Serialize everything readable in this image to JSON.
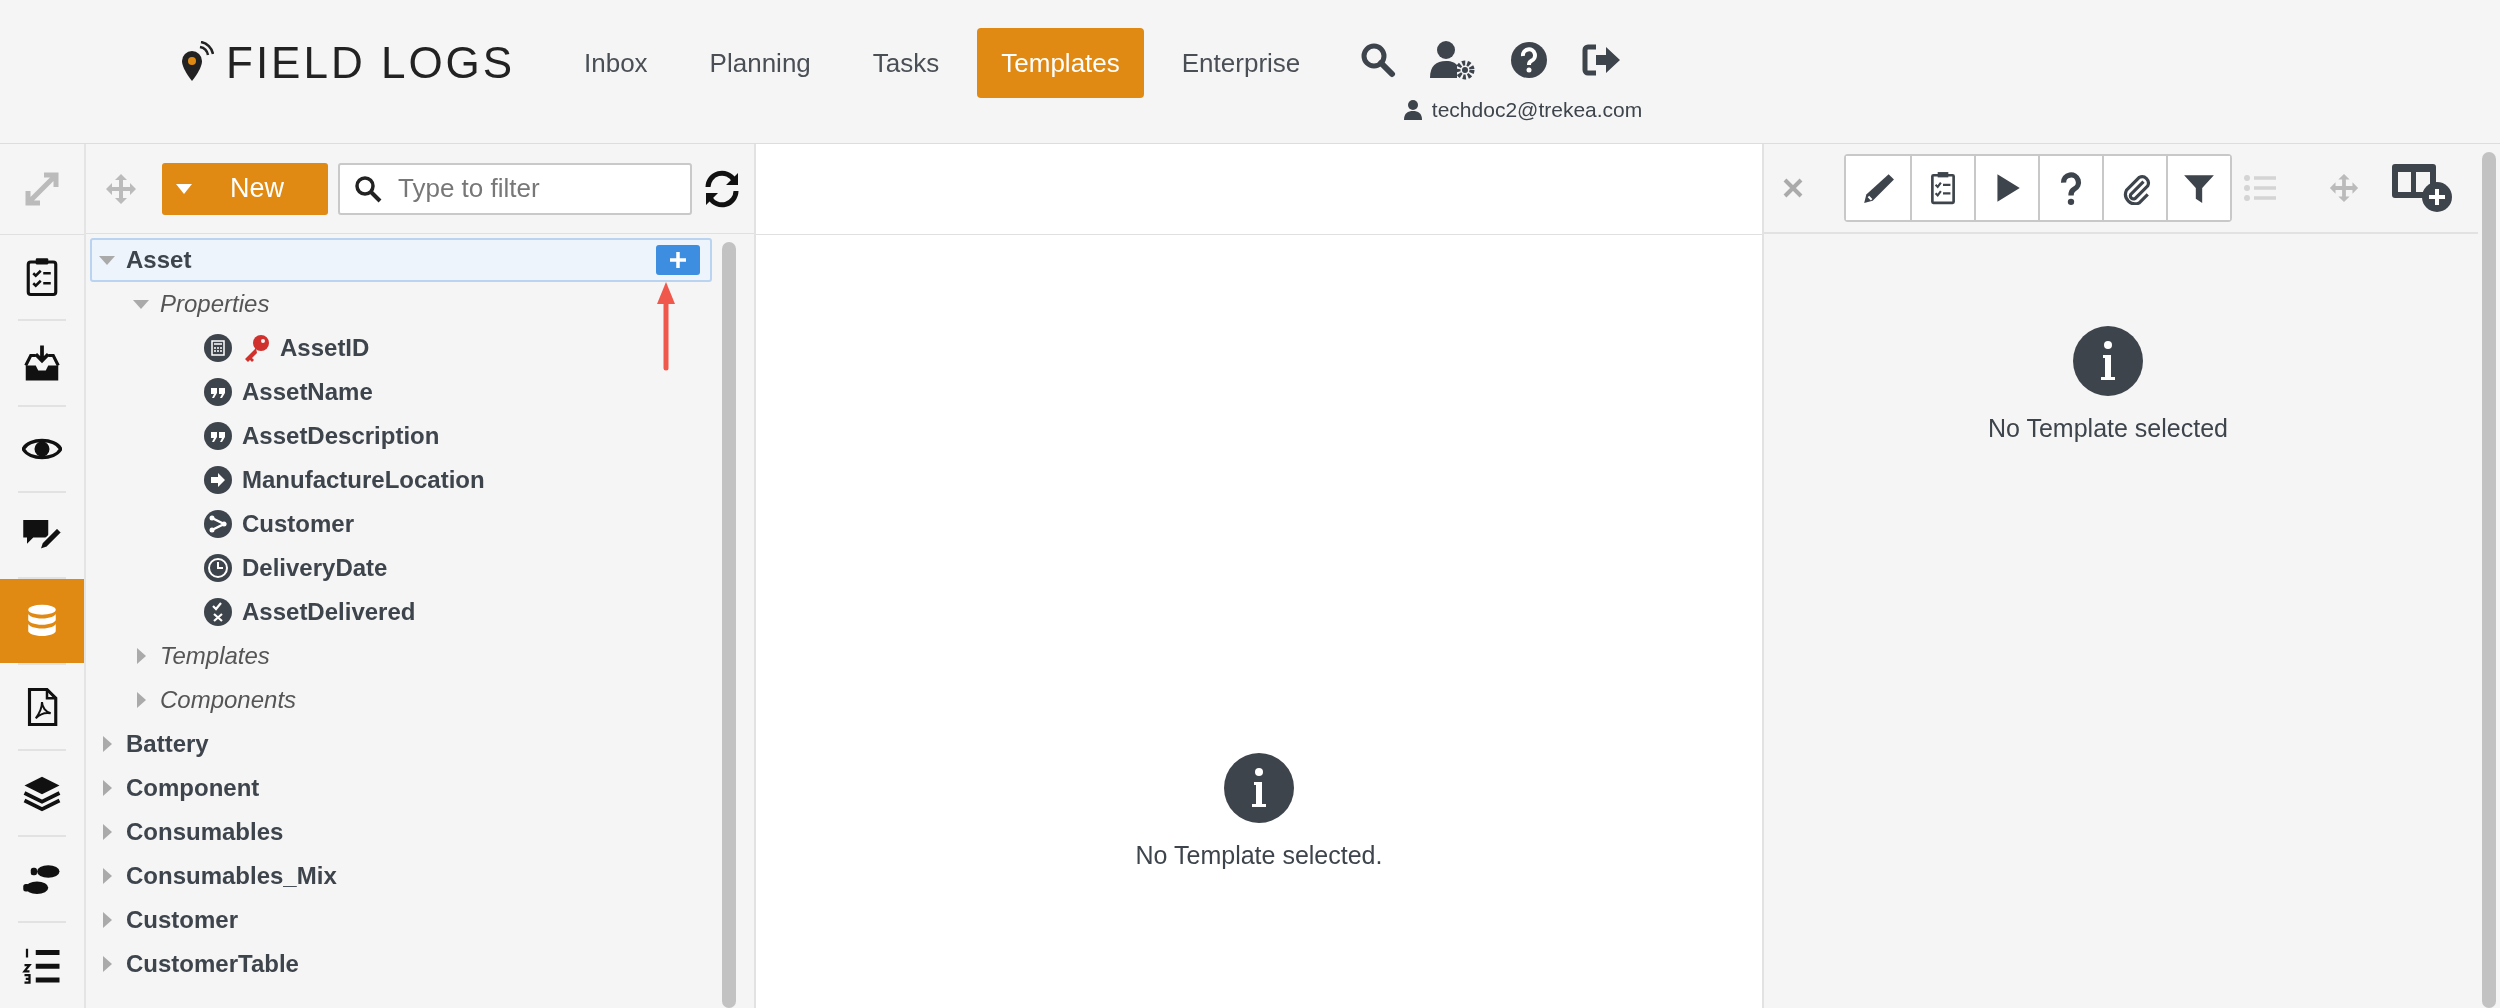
{
  "logo": {
    "text": "FIELD LOGS"
  },
  "nav": [
    {
      "label": "Inbox",
      "selected": false
    },
    {
      "label": "Planning",
      "selected": false
    },
    {
      "label": "Tasks",
      "selected": false
    },
    {
      "label": "Templates",
      "selected": true
    },
    {
      "label": "Enterprise",
      "selected": false
    }
  ],
  "user": {
    "email": "techdoc2@trekea.com"
  },
  "rail": [
    {
      "kind": "checklist",
      "selected": false
    },
    {
      "kind": "inbox",
      "selected": false
    },
    {
      "kind": "eye",
      "selected": false
    },
    {
      "kind": "comment",
      "selected": false
    },
    {
      "kind": "database",
      "selected": true
    },
    {
      "kind": "pdf",
      "selected": false
    },
    {
      "kind": "layers",
      "selected": false
    },
    {
      "kind": "steps",
      "selected": false
    },
    {
      "kind": "list",
      "selected": false
    }
  ],
  "tree_toolbar": {
    "new_button": "New",
    "filter": {
      "placeholder": "Type to filter"
    }
  },
  "tree": [
    {
      "label": "Asset",
      "expanded": true,
      "selected": true,
      "children": [
        {
          "label": "Properties",
          "expanded": true,
          "children": [
            {
              "label": "AssetID",
              "kind": "calculated",
              "key": true
            },
            {
              "label": "AssetName",
              "kind": "text",
              "key": false
            },
            {
              "label": "AssetDescription",
              "kind": "text",
              "key": false
            },
            {
              "label": "ManufactureLocation",
              "kind": "link",
              "key": false
            },
            {
              "label": "Customer",
              "kind": "relation",
              "key": false
            },
            {
              "label": "DeliveryDate",
              "kind": "date",
              "key": false
            },
            {
              "label": "AssetDelivered",
              "kind": "boolean",
              "key": false
            }
          ]
        },
        {
          "label": "Templates",
          "expanded": false
        },
        {
          "label": "Components",
          "expanded": false
        }
      ]
    },
    {
      "label": "Battery",
      "expanded": false,
      "selected": false
    },
    {
      "label": "Component",
      "expanded": false,
      "selected": false
    },
    {
      "label": "Consumables",
      "expanded": false,
      "selected": false
    },
    {
      "label": "Consumables_Mix",
      "expanded": false,
      "selected": false
    },
    {
      "label": "Customer",
      "expanded": false,
      "selected": false
    },
    {
      "label": "CustomerTable",
      "expanded": false,
      "selected": false
    }
  ],
  "center": {
    "message": "No Template selected."
  },
  "right": {
    "message": "No Template selected",
    "list_disabled": true
  }
}
